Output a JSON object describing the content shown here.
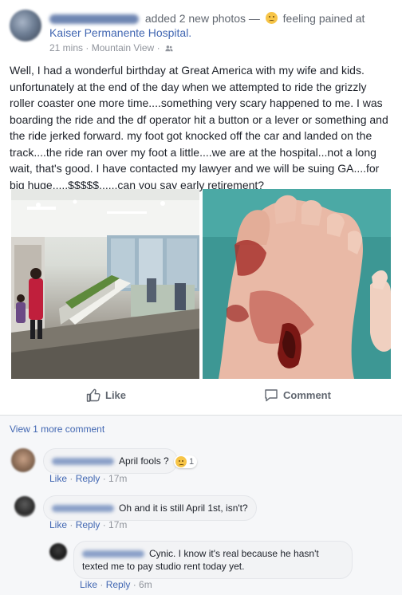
{
  "post": {
    "action_text": "added 2 new photos —",
    "feeling_text": "feeling pained at",
    "location": "Kaiser Permanente Hospital.",
    "time": "21 mins",
    "place": "Mountain View",
    "body": "Well, I had a wonderful birthday at Great America with my wife and kids. unfortunately at the end of the day when we attempted to ride the grizzly roller coaster one more time....something very scary happened to me. I was boarding the ride and the df operator hit a button or a lever or something and the ride jerked forward. my foot got knocked off the car and landed on the track....the ride ran over my foot a little....we are at the hospital...not a long wait, that's good. I have contacted my lawyer and we will be suing GA....for big huge.....$$$$$......can you say early retirement?",
    "like_label": "Like",
    "comment_label": "Comment"
  },
  "comments": {
    "view_more": "View 1 more comment",
    "items": [
      {
        "text": "April fools ?",
        "reaction_count": "1",
        "like": "Like",
        "reply": "Reply",
        "time": "17m"
      },
      {
        "text": "Oh and it is still April 1st, isn't?",
        "like": "Like",
        "reply": "Reply",
        "time": "17m"
      },
      {
        "text": "Cynic. I know it's real because he hasn't texted me to pay studio rent today yet.",
        "like": "Like",
        "reply": "Reply",
        "time": "6m"
      }
    ]
  },
  "icons": [
    "sad-emoji-icon",
    "friends-icon",
    "like-thumb-icon",
    "comment-bubble-icon"
  ],
  "colors": {
    "link": "#4267b2",
    "muted": "#90949c",
    "comment_bg": "#f6f7f9"
  }
}
